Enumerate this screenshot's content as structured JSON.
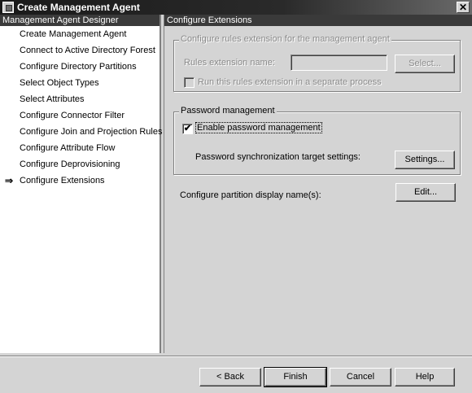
{
  "window": {
    "title": "Create Management Agent",
    "close_glyph": "✕"
  },
  "left": {
    "header": "Management Agent Designer",
    "current_marker": "⇒",
    "items": [
      {
        "label": "Create Management Agent"
      },
      {
        "label": "Connect to Active Directory Forest"
      },
      {
        "label": "Configure Directory Partitions"
      },
      {
        "label": "Select Object Types"
      },
      {
        "label": "Select Attributes"
      },
      {
        "label": "Configure Connector Filter"
      },
      {
        "label": "Configure Join and Projection Rules"
      },
      {
        "label": "Configure Attribute Flow"
      },
      {
        "label": "Configure Deprovisioning"
      },
      {
        "label": "Configure Extensions"
      }
    ]
  },
  "right": {
    "header": "Configure Extensions",
    "rules_group": {
      "legend": "Configure rules extension for the management agent",
      "name_label": "Rules extension name:",
      "name_value": "",
      "select_button": "Select...",
      "separate_process_label": "Run this rules extension in a separate process",
      "separate_process_checked": false
    },
    "password_group": {
      "legend": "Password management",
      "enable_label": "Enable password management",
      "enable_checked": true,
      "check_glyph": "✔",
      "sync_label": "Password synchronization target settings:",
      "settings_button": "Settings..."
    },
    "partition_label": "Configure partition display name(s):",
    "edit_button": "Edit..."
  },
  "footer": {
    "back_button": "< Back",
    "finish_button": "Finish",
    "cancel_button": "Cancel",
    "help_button": "Help"
  }
}
